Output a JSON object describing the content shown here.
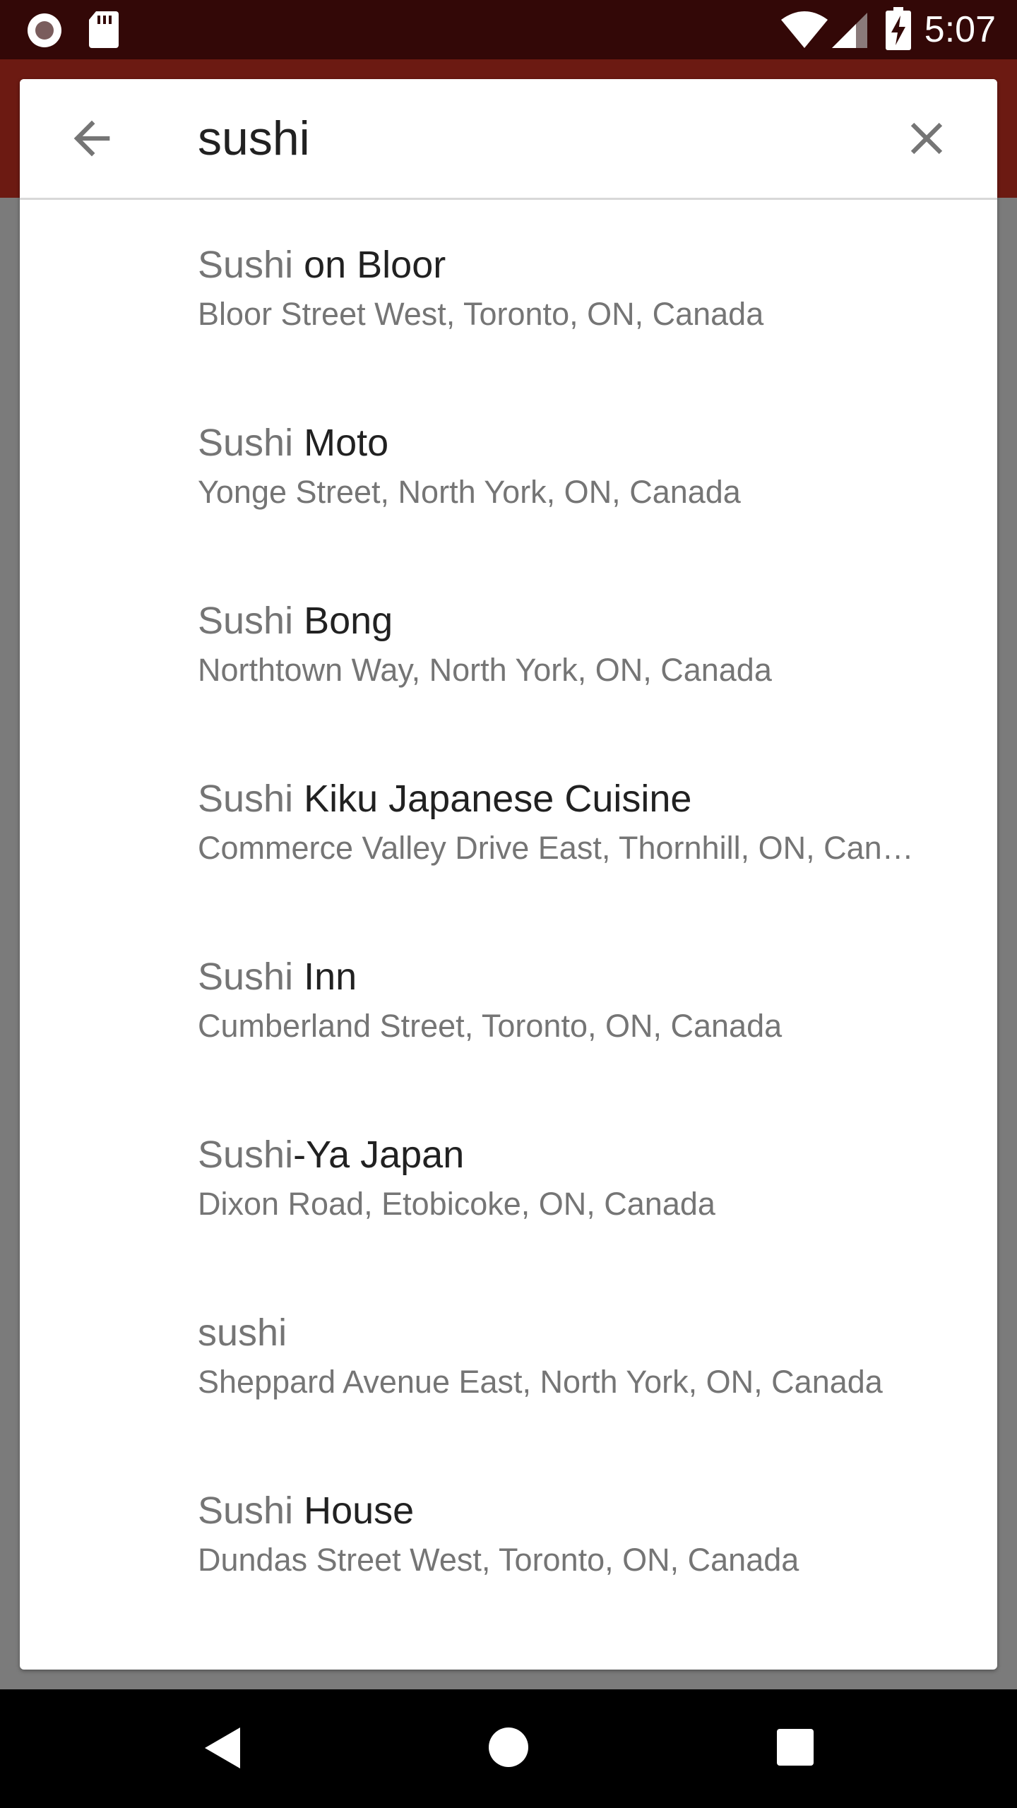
{
  "status_bar": {
    "time": "5:07",
    "left_icons": [
      "record-icon",
      "sd-card-icon"
    ],
    "right_icons": [
      "wifi-icon",
      "cell-signal-icon",
      "battery-charging-icon"
    ]
  },
  "search": {
    "query": "sushi",
    "back_icon": "arrow-back-icon",
    "clear_icon": "close-icon"
  },
  "results": [
    {
      "match": "Sushi",
      "rest": " on Bloor",
      "address": "Bloor Street West, Toronto, ON, Canada"
    },
    {
      "match": "Sushi",
      "rest": " Moto",
      "address": "Yonge Street, North York, ON, Canada"
    },
    {
      "match": "Sushi",
      "rest": " Bong",
      "address": "Northtown Way, North York, ON, Canada"
    },
    {
      "match": "Sushi",
      "rest": " Kiku Japanese Cuisine",
      "address": "Commerce Valley Drive East, Thornhill, ON, Can…"
    },
    {
      "match": "Sushi",
      "rest": " Inn",
      "address": "Cumberland Street, Toronto, ON, Canada"
    },
    {
      "match": "Sushi",
      "rest": "-Ya Japan",
      "address": "Dixon Road, Etobicoke, ON, Canada"
    },
    {
      "match": "sushi",
      "rest": "",
      "address": "Sheppard Avenue East, North York, ON, Canada"
    },
    {
      "match": "Sushi",
      "rest": " House",
      "address": "Dundas Street West, Toronto, ON, Canada"
    }
  ],
  "nav_bar": {
    "icons": [
      "back-triangle-icon",
      "home-circle-icon",
      "recents-square-icon"
    ]
  },
  "colors": {
    "status_bar": "#330807",
    "app_bar": "#6c1a12",
    "scrim": "#7b7b7b",
    "match_text": "#757575",
    "primary_text": "#212121"
  }
}
